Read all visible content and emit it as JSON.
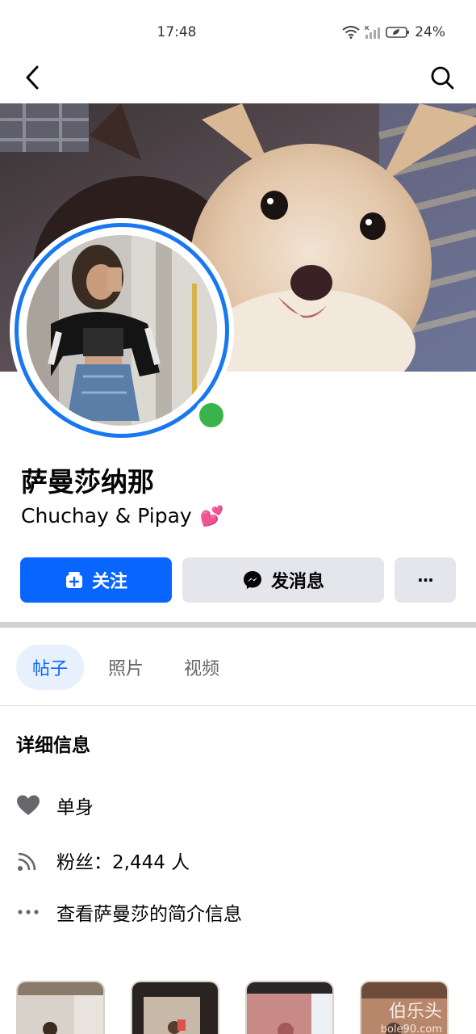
{
  "status_bar": {
    "time": "17:48",
    "battery": "24%"
  },
  "profile": {
    "name": "萨曼莎纳那",
    "bio": "Chuchay & Pipay",
    "bio_emoji": "💕"
  },
  "actions": {
    "follow_label": "关注",
    "message_label": "发消息",
    "more_label": "···"
  },
  "tabs": [
    {
      "label": "帖子",
      "active": true
    },
    {
      "label": "照片",
      "active": false
    },
    {
      "label": "视频",
      "active": false
    }
  ],
  "details": {
    "title": "详细信息",
    "relationship": "单身",
    "followers": "粉丝：2,444 人",
    "about_link": "查看萨曼莎的简介信息"
  },
  "watermark": {
    "main": "伯乐头",
    "sub": "bole90.com"
  },
  "colors": {
    "accent": "#0866ff",
    "ring": "#1877f2",
    "online": "#3ab44a",
    "secondary_button": "#e4e6eb"
  }
}
